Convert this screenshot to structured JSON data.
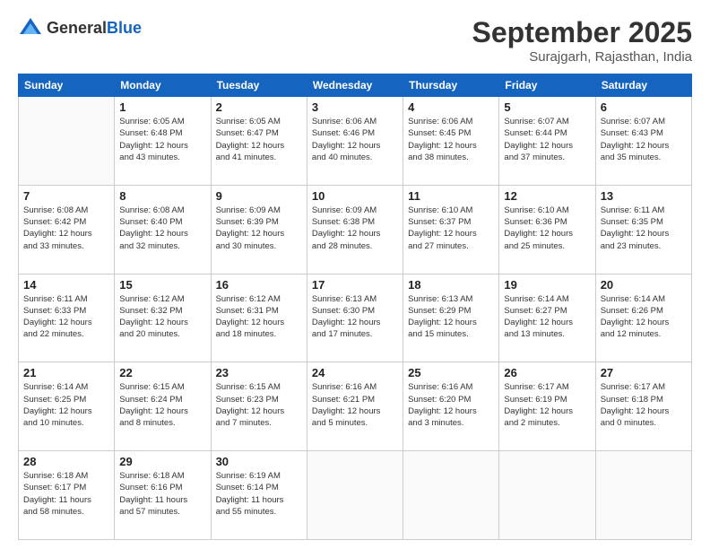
{
  "header": {
    "logo_general": "General",
    "logo_blue": "Blue",
    "title": "September 2025",
    "subtitle": "Surajgarh, Rajasthan, India"
  },
  "weekdays": [
    "Sunday",
    "Monday",
    "Tuesday",
    "Wednesday",
    "Thursday",
    "Friday",
    "Saturday"
  ],
  "weeks": [
    [
      {
        "day": "",
        "info": ""
      },
      {
        "day": "1",
        "info": "Sunrise: 6:05 AM\nSunset: 6:48 PM\nDaylight: 12 hours\nand 43 minutes."
      },
      {
        "day": "2",
        "info": "Sunrise: 6:05 AM\nSunset: 6:47 PM\nDaylight: 12 hours\nand 41 minutes."
      },
      {
        "day": "3",
        "info": "Sunrise: 6:06 AM\nSunset: 6:46 PM\nDaylight: 12 hours\nand 40 minutes."
      },
      {
        "day": "4",
        "info": "Sunrise: 6:06 AM\nSunset: 6:45 PM\nDaylight: 12 hours\nand 38 minutes."
      },
      {
        "day": "5",
        "info": "Sunrise: 6:07 AM\nSunset: 6:44 PM\nDaylight: 12 hours\nand 37 minutes."
      },
      {
        "day": "6",
        "info": "Sunrise: 6:07 AM\nSunset: 6:43 PM\nDaylight: 12 hours\nand 35 minutes."
      }
    ],
    [
      {
        "day": "7",
        "info": "Sunrise: 6:08 AM\nSunset: 6:42 PM\nDaylight: 12 hours\nand 33 minutes."
      },
      {
        "day": "8",
        "info": "Sunrise: 6:08 AM\nSunset: 6:40 PM\nDaylight: 12 hours\nand 32 minutes."
      },
      {
        "day": "9",
        "info": "Sunrise: 6:09 AM\nSunset: 6:39 PM\nDaylight: 12 hours\nand 30 minutes."
      },
      {
        "day": "10",
        "info": "Sunrise: 6:09 AM\nSunset: 6:38 PM\nDaylight: 12 hours\nand 28 minutes."
      },
      {
        "day": "11",
        "info": "Sunrise: 6:10 AM\nSunset: 6:37 PM\nDaylight: 12 hours\nand 27 minutes."
      },
      {
        "day": "12",
        "info": "Sunrise: 6:10 AM\nSunset: 6:36 PM\nDaylight: 12 hours\nand 25 minutes."
      },
      {
        "day": "13",
        "info": "Sunrise: 6:11 AM\nSunset: 6:35 PM\nDaylight: 12 hours\nand 23 minutes."
      }
    ],
    [
      {
        "day": "14",
        "info": "Sunrise: 6:11 AM\nSunset: 6:33 PM\nDaylight: 12 hours\nand 22 minutes."
      },
      {
        "day": "15",
        "info": "Sunrise: 6:12 AM\nSunset: 6:32 PM\nDaylight: 12 hours\nand 20 minutes."
      },
      {
        "day": "16",
        "info": "Sunrise: 6:12 AM\nSunset: 6:31 PM\nDaylight: 12 hours\nand 18 minutes."
      },
      {
        "day": "17",
        "info": "Sunrise: 6:13 AM\nSunset: 6:30 PM\nDaylight: 12 hours\nand 17 minutes."
      },
      {
        "day": "18",
        "info": "Sunrise: 6:13 AM\nSunset: 6:29 PM\nDaylight: 12 hours\nand 15 minutes."
      },
      {
        "day": "19",
        "info": "Sunrise: 6:14 AM\nSunset: 6:27 PM\nDaylight: 12 hours\nand 13 minutes."
      },
      {
        "day": "20",
        "info": "Sunrise: 6:14 AM\nSunset: 6:26 PM\nDaylight: 12 hours\nand 12 minutes."
      }
    ],
    [
      {
        "day": "21",
        "info": "Sunrise: 6:14 AM\nSunset: 6:25 PM\nDaylight: 12 hours\nand 10 minutes."
      },
      {
        "day": "22",
        "info": "Sunrise: 6:15 AM\nSunset: 6:24 PM\nDaylight: 12 hours\nand 8 minutes."
      },
      {
        "day": "23",
        "info": "Sunrise: 6:15 AM\nSunset: 6:23 PM\nDaylight: 12 hours\nand 7 minutes."
      },
      {
        "day": "24",
        "info": "Sunrise: 6:16 AM\nSunset: 6:21 PM\nDaylight: 12 hours\nand 5 minutes."
      },
      {
        "day": "25",
        "info": "Sunrise: 6:16 AM\nSunset: 6:20 PM\nDaylight: 12 hours\nand 3 minutes."
      },
      {
        "day": "26",
        "info": "Sunrise: 6:17 AM\nSunset: 6:19 PM\nDaylight: 12 hours\nand 2 minutes."
      },
      {
        "day": "27",
        "info": "Sunrise: 6:17 AM\nSunset: 6:18 PM\nDaylight: 12 hours\nand 0 minutes."
      }
    ],
    [
      {
        "day": "28",
        "info": "Sunrise: 6:18 AM\nSunset: 6:17 PM\nDaylight: 11 hours\nand 58 minutes."
      },
      {
        "day": "29",
        "info": "Sunrise: 6:18 AM\nSunset: 6:16 PM\nDaylight: 11 hours\nand 57 minutes."
      },
      {
        "day": "30",
        "info": "Sunrise: 6:19 AM\nSunset: 6:14 PM\nDaylight: 11 hours\nand 55 minutes."
      },
      {
        "day": "",
        "info": ""
      },
      {
        "day": "",
        "info": ""
      },
      {
        "day": "",
        "info": ""
      },
      {
        "day": "",
        "info": ""
      }
    ]
  ]
}
